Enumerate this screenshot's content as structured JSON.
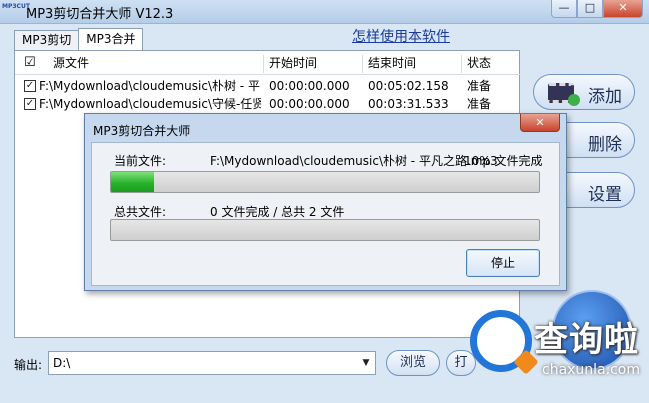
{
  "window": {
    "title": "MP3剪切合并大师 V12.3",
    "logo_text": "MP3CUT",
    "minimize": "—",
    "maximize": "□",
    "close": "✕"
  },
  "help_link": "怎样使用本软件",
  "tabs": [
    {
      "label": "MP3剪切",
      "active": false
    },
    {
      "label": "MP3合并",
      "active": true
    }
  ],
  "table": {
    "headers": {
      "check": "☑",
      "source": "源文件",
      "start": "开始时间",
      "end": "结束时间",
      "status": "状态"
    },
    "rows": [
      {
        "checked": true,
        "source": "F:\\Mydownload\\cloudemusic\\朴树 - 平...",
        "start": "00:00:00.000",
        "end": "00:05:02.158",
        "status": "准备"
      },
      {
        "checked": true,
        "source": "F:\\Mydownload\\cloudemusic\\守候-任贤...",
        "start": "00:00:00.000",
        "end": "00:03:31.533",
        "status": "准备"
      }
    ]
  },
  "side_buttons": {
    "add": "添加",
    "delete": "删除",
    "settings": "设置"
  },
  "output": {
    "label": "输出:",
    "value": "D:\\",
    "browse": "浏览",
    "open": "打"
  },
  "dialog": {
    "title": "MP3剪切合并大师",
    "close": "✕",
    "current_label": "当前文件:",
    "current_file": "F:\\Mydownload\\cloudemusic\\朴树 - 平凡之路.mp3",
    "current_progress_text": "10% 文件完成",
    "current_progress": 0.1,
    "total_label": "总共文件:",
    "total_text": "0 文件完成 / 总共 2 文件",
    "total_progress": 0.0,
    "stop": "停止"
  },
  "watermark": {
    "text": "查询啦",
    "sub": "chaxunla.com"
  }
}
